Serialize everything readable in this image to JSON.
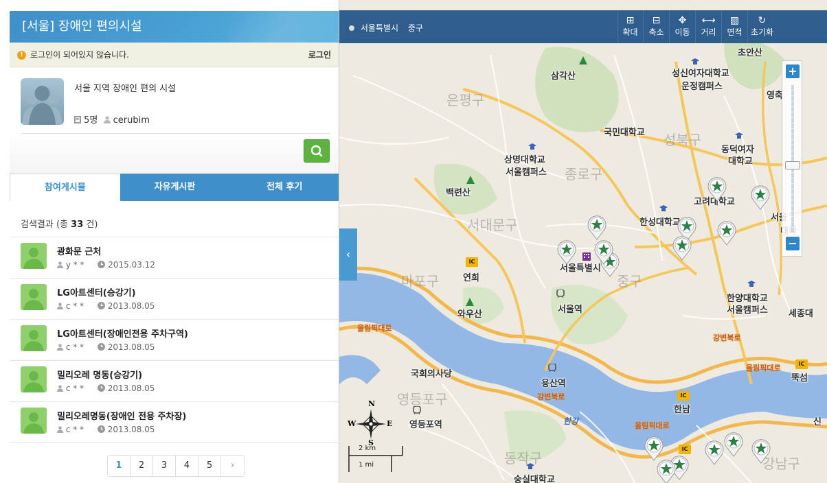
{
  "panel": {
    "title": "[서울] 장애인 편의시설",
    "login_message": "로그인이 되어있지 않습니다.",
    "login_link": "로그인",
    "group_desc": "서울 지역 장애인 편의 시설",
    "member_count": "5명",
    "owner": "cerubim"
  },
  "tabs": [
    {
      "label": "참여게시물"
    },
    {
      "label": "자유게시판"
    },
    {
      "label": "전체 후기"
    }
  ],
  "results": {
    "prefix": "검색결과 (총",
    "count": "33",
    "suffix": "건)"
  },
  "items": [
    {
      "title": "광화문 근처",
      "user": "y * *",
      "date": "2015.03.12"
    },
    {
      "title": "LG아트센터(승강기)",
      "user": "c * *",
      "date": "2013.08.05"
    },
    {
      "title": "LG아트센터(장애인전용 주차구역)",
      "user": "c * *",
      "date": "2013.08.05"
    },
    {
      "title": "밀리오레 명동(승강기)",
      "user": "c * *",
      "date": "2013.08.05"
    },
    {
      "title": "밀리오레명동(장애인 전용 주차장)",
      "user": "c * *",
      "date": "2013.08.05"
    }
  ],
  "pagination": [
    "1",
    "2",
    "3",
    "4",
    "5",
    "›"
  ],
  "map": {
    "location_city": "서울특별시",
    "location_gu": "중구",
    "tools": [
      {
        "glyph": "⊞",
        "label": "확대",
        "name": "zoom-in-tool"
      },
      {
        "glyph": "⊟",
        "label": "축소",
        "name": "zoom-out-tool"
      },
      {
        "glyph": "✥",
        "label": "이동",
        "name": "pan-tool"
      },
      {
        "glyph": "⟷",
        "label": "거리",
        "name": "distance-tool"
      },
      {
        "glyph": "▨",
        "label": "면적",
        "name": "area-tool"
      },
      {
        "glyph": "↻",
        "label": "초기화",
        "name": "reset-tool"
      }
    ],
    "labels": [
      "삼각산",
      "성신여자대학교",
      "운정캠퍼스",
      "초안산",
      "영축",
      "은평구",
      "국민대학교",
      "성북구",
      "상명대학교",
      "서울캠퍼스",
      "종로구",
      "동덕여자",
      "대학교",
      "백련산",
      "고려대학교",
      "서대문구",
      "한성대학교",
      "서울",
      "대학",
      "서울특별시",
      "연희",
      "마포구",
      "중구",
      "서울역",
      "와우산",
      "한양대학교",
      "서울캠퍼스",
      "세종대",
      "국회의사당",
      "용산역",
      "영등포구",
      "한남",
      "영등포역",
      "동작구",
      "숭실대학교",
      "강남구",
      "뚝섬",
      "신",
      "한강",
      "강변북로",
      "올림픽대로",
      "강변북로",
      "올림픽대로",
      "올림픽대로"
    ],
    "ic_badge": "IC",
    "scale_km": "2 km",
    "scale_mi": "1 mi",
    "compass": {
      "n": "N",
      "s": "S",
      "e": "E",
      "w": "W"
    },
    "zoom_plus": "+",
    "zoom_minus": "−",
    "collapse": "‹"
  }
}
